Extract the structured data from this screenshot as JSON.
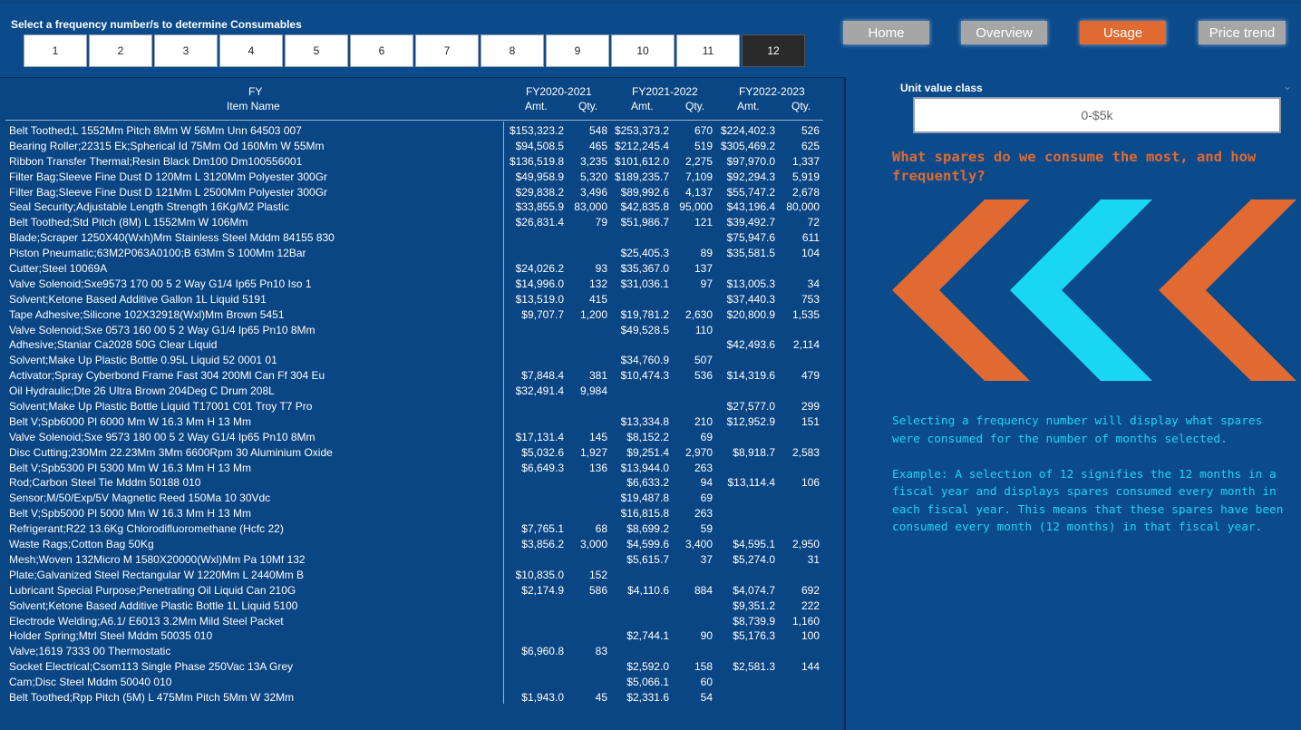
{
  "slicer": {
    "title": "Select a frequency number/s to determine Consumables",
    "options": [
      "1",
      "2",
      "3",
      "4",
      "5",
      "6",
      "7",
      "8",
      "9",
      "10",
      "11",
      "12"
    ],
    "selected": "12"
  },
  "nav": {
    "home": "Home",
    "overview": "Overview",
    "usage": "Usage",
    "price_trend": "Price trend"
  },
  "table": {
    "header_fy": "FY",
    "header_item": "Item Name",
    "fy1": "FY2020-2021",
    "fy2": "FY2021-2022",
    "fy3": "FY2022-2023",
    "amt": "Amt.",
    "qty": "Qty.",
    "rows": [
      {
        "name": "Belt Toothed;L 1552Mm Pitch 8Mm W 56Mm Unn 64503 007",
        "a1": "$153,323.2",
        "q1": "548",
        "a2": "$253,373.2",
        "q2": "670",
        "a3": "$224,402.3",
        "q3": "526"
      },
      {
        "name": "Bearing Roller;22315 Ek;Spherical Id 75Mm Od 160Mm W 55Mm",
        "a1": "$94,508.5",
        "q1": "465",
        "a2": "$212,245.4",
        "q2": "519",
        "a3": "$305,469.2",
        "q3": "625"
      },
      {
        "name": "Ribbon Transfer Thermal;Resin Black Dm100 Dm100556001",
        "a1": "$136,519.8",
        "q1": "3,235",
        "a2": "$101,612.0",
        "q2": "2,275",
        "a3": "$97,970.0",
        "q3": "1,337"
      },
      {
        "name": "Filter Bag;Sleeve Fine Dust D 120Mm L 3120Mm Polyester 300Gr",
        "a1": "$49,958.9",
        "q1": "5,320",
        "a2": "$189,235.7",
        "q2": "7,109",
        "a3": "$92,294.3",
        "q3": "5,919"
      },
      {
        "name": "Filter Bag;Sleeve Fine Dust D 121Mm L 2500Mm Polyester 300Gr",
        "a1": "$29,838.2",
        "q1": "3,496",
        "a2": "$89,992.6",
        "q2": "4,137",
        "a3": "$55,747.2",
        "q3": "2,678"
      },
      {
        "name": "Seal Security;Adjustable Length Strength 16Kg/M2 Plastic",
        "a1": "$33,855.9",
        "q1": "83,000",
        "a2": "$42,835.8",
        "q2": "95,000",
        "a3": "$43,196.4",
        "q3": "80,000"
      },
      {
        "name": "Belt Toothed;Std Pitch (8M) L 1552Mm W 106Mm",
        "a1": "$26,831.4",
        "q1": "79",
        "a2": "$51,986.7",
        "q2": "121",
        "a3": "$39,492.7",
        "q3": "72"
      },
      {
        "name": "Blade;Scraper 1250X40(Wxh)Mm Stainless Steel Mddm 84155 830",
        "a1": "",
        "q1": "",
        "a2": "",
        "q2": "",
        "a3": "$75,947.6",
        "q3": "611"
      },
      {
        "name": "Piston Pneumatic;63M2P063A0100;B 63Mm S 100Mm 12Bar",
        "a1": "",
        "q1": "",
        "a2": "$25,405.3",
        "q2": "89",
        "a3": "$35,581.5",
        "q3": "104"
      },
      {
        "name": "Cutter;Steel 10069A",
        "a1": "$24,026.2",
        "q1": "93",
        "a2": "$35,367.0",
        "q2": "137",
        "a3": "",
        "q3": ""
      },
      {
        "name": "Valve Solenoid;Sxe9573 170 00 5 2 Way G1/4 Ip65 Pn10 Iso 1",
        "a1": "$14,996.0",
        "q1": "132",
        "a2": "$31,036.1",
        "q2": "97",
        "a3": "$13,005.3",
        "q3": "34"
      },
      {
        "name": "Solvent;Ketone Based Additive Gallon 1L Liquid 5191",
        "a1": "$13,519.0",
        "q1": "415",
        "a2": "",
        "q2": "",
        "a3": "$37,440.3",
        "q3": "753"
      },
      {
        "name": "Tape Adhesive;Silicone 102X32918(Wxl)Mm Brown 5451",
        "a1": "$9,707.7",
        "q1": "1,200",
        "a2": "$19,781.2",
        "q2": "2,630",
        "a3": "$20,800.9",
        "q3": "1,535"
      },
      {
        "name": "Valve Solenoid;Sxe 0573 160 00 5 2 Way G1/4 Ip65 Pn10 8Mm",
        "a1": "",
        "q1": "",
        "a2": "$49,528.5",
        "q2": "110",
        "a3": "",
        "q3": ""
      },
      {
        "name": "Adhesive;Staniar Ca2028 50G Clear Liquid",
        "a1": "",
        "q1": "",
        "a2": "",
        "q2": "",
        "a3": "$42,493.6",
        "q3": "2,114"
      },
      {
        "name": "Solvent;Make Up Plastic Bottle 0.95L Liquid 52 0001 01",
        "a1": "",
        "q1": "",
        "a2": "$34,760.9",
        "q2": "507",
        "a3": "",
        "q3": ""
      },
      {
        "name": "Activator;Spray Cyberbond Frame Fast 304 200Ml Can Ff 304 Eu",
        "a1": "$7,848.4",
        "q1": "381",
        "a2": "$10,474.3",
        "q2": "536",
        "a3": "$14,319.6",
        "q3": "479"
      },
      {
        "name": "Oil Hydraulic;Dte 26 Ultra Brown 204Deg C Drum 208L",
        "a1": "$32,491.4",
        "q1": "9,984",
        "a2": "",
        "q2": "",
        "a3": "",
        "q3": ""
      },
      {
        "name": "Solvent;Make Up Plastic Bottle Liquid T17001 C01 Troy T7 Pro",
        "a1": "",
        "q1": "",
        "a2": "",
        "q2": "",
        "a3": "$27,577.0",
        "q3": "299"
      },
      {
        "name": "Belt V;Spb6000 Pl 6000 Mm W 16.3 Mm H 13 Mm",
        "a1": "",
        "q1": "",
        "a2": "$13,334.8",
        "q2": "210",
        "a3": "$12,952.9",
        "q3": "151"
      },
      {
        "name": "Valve Solenoid;Sxe 9573 180 00 5 2 Way G1/4 Ip65 Pn10 8Mm",
        "a1": "$17,131.4",
        "q1": "145",
        "a2": "$8,152.2",
        "q2": "69",
        "a3": "",
        "q3": ""
      },
      {
        "name": "Disc Cutting;230Mm 22.23Mm 3Mm 6600Rpm 30 Aluminium Oxide",
        "a1": "$5,032.6",
        "q1": "1,927",
        "a2": "$9,251.4",
        "q2": "2,970",
        "a3": "$8,918.7",
        "q3": "2,583"
      },
      {
        "name": "Belt V;Spb5300 Pl 5300 Mm W 16.3 Mm H 13 Mm",
        "a1": "$6,649.3",
        "q1": "136",
        "a2": "$13,944.0",
        "q2": "263",
        "a3": "",
        "q3": ""
      },
      {
        "name": "Rod;Carbon Steel Tie Mddm 50188 010",
        "a1": "",
        "q1": "",
        "a2": "$6,633.2",
        "q2": "94",
        "a3": "$13,114.4",
        "q3": "106"
      },
      {
        "name": "Sensor;M/50/Exp/5V Magnetic Reed 150Ma 10 30Vdc",
        "a1": "",
        "q1": "",
        "a2": "$19,487.8",
        "q2": "69",
        "a3": "",
        "q3": ""
      },
      {
        "name": "Belt V;Spb5000 Pl 5000 Mm W 16.3 Mm H 13 Mm",
        "a1": "",
        "q1": "",
        "a2": "$16,815.8",
        "q2": "263",
        "a3": "",
        "q3": ""
      },
      {
        "name": "Refrigerant;R22 13.6Kg Chlorodifluoromethane (Hcfc 22)",
        "a1": "$7,765.1",
        "q1": "68",
        "a2": "$8,699.2",
        "q2": "59",
        "a3": "",
        "q3": ""
      },
      {
        "name": "Waste Rags;Cotton Bag 50Kg",
        "a1": "$3,856.2",
        "q1": "3,000",
        "a2": "$4,599.6",
        "q2": "3,400",
        "a3": "$4,595.1",
        "q3": "2,950"
      },
      {
        "name": "Mesh;Woven 132Micro M 1580X20000(Wxl)Mm Pa 10Mf 132",
        "a1": "",
        "q1": "",
        "a2": "$5,615.7",
        "q2": "37",
        "a3": "$5,274.0",
        "q3": "31"
      },
      {
        "name": "Plate;Galvanized Steel Rectangular W 1220Mm L 2440Mm B",
        "a1": "$10,835.0",
        "q1": "152",
        "a2": "",
        "q2": "",
        "a3": "",
        "q3": ""
      },
      {
        "name": "Lubricant Special Purpose;Penetrating Oil Liquid Can 210G",
        "a1": "$2,174.9",
        "q1": "586",
        "a2": "$4,110.6",
        "q2": "884",
        "a3": "$4,074.7",
        "q3": "692"
      },
      {
        "name": "Solvent;Ketone Based Additive Plastic Bottle 1L Liquid 5100",
        "a1": "",
        "q1": "",
        "a2": "",
        "q2": "",
        "a3": "$9,351.2",
        "q3": "222"
      },
      {
        "name": "Electrode Welding;A6.1/ E6013 3.2Mm Mild Steel Packet",
        "a1": "",
        "q1": "",
        "a2": "",
        "q2": "",
        "a3": "$8,739.9",
        "q3": "1,160"
      },
      {
        "name": "Holder Spring;Mtrl Steel Mddm 50035 010",
        "a1": "",
        "q1": "",
        "a2": "$2,744.1",
        "q2": "90",
        "a3": "$5,176.3",
        "q3": "100"
      },
      {
        "name": "Valve;1619 7333 00 Thermostatic",
        "a1": "$6,960.8",
        "q1": "83",
        "a2": "",
        "q2": "",
        "a3": "",
        "q3": ""
      },
      {
        "name": "Socket Electrical;Csom113 Single Phase 250Vac 13A Grey",
        "a1": "",
        "q1": "",
        "a2": "$2,592.0",
        "q2": "158",
        "a3": "$2,581.3",
        "q3": "144"
      },
      {
        "name": "Cam;Disc Steel Mddm 50040 010",
        "a1": "",
        "q1": "",
        "a2": "$5,066.1",
        "q2": "60",
        "a3": "",
        "q3": ""
      },
      {
        "name": "Belt Toothed;Rpp Pitch (5M) L 475Mm Pitch 5Mm W 32Mm",
        "a1": "$1,943.0",
        "q1": "45",
        "a2": "$2,331.6",
        "q2": "54",
        "a3": "",
        "q3": ""
      }
    ]
  },
  "unit_slicer": {
    "label": "Unit value class",
    "value": "0-$5k"
  },
  "question": "What spares do we consume the most, and how frequently?",
  "description": {
    "p1": "Selecting a frequency number will display what spares were consumed for the number of months selected.",
    "p2": "Example: A selection of 12 signifies the 12 months in a fiscal year and displays spares consumed every month in each fiscal year. This means that these spares have been consumed every month (12 months) in that fiscal year."
  },
  "colors": {
    "background": "#0b4a8b",
    "orange": "#e06a32",
    "cyan": "#19d6f2"
  },
  "decor": {
    "arrows_icon": "chevron-arrows-left-icon"
  }
}
